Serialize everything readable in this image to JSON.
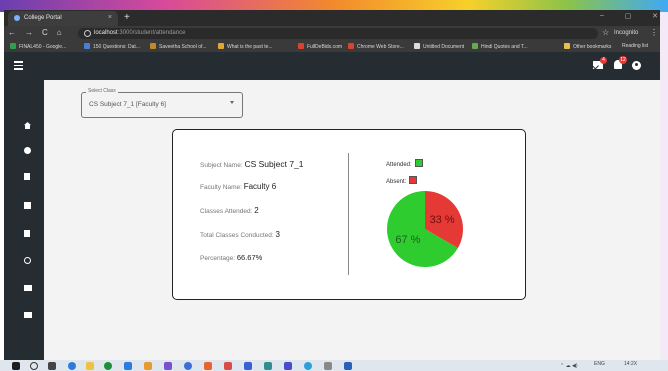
{
  "browser": {
    "tab_title": "College Portal",
    "tab_close": "×",
    "new_tab": "+",
    "window_controls": [
      "–",
      "▢",
      "✕"
    ],
    "nav_buttons": [
      "←",
      "→",
      "C",
      "⌂"
    ],
    "url_host": "localhost",
    "url_path": ":3000/student/attendance",
    "incognito_label": "Incognito",
    "menu_dots": "⋮",
    "bookmarks": [
      {
        "label": "FINAL450 - Google...",
        "color": "#2e9e4f"
      },
      {
        "label": "150 Questions: Dat...",
        "color": "#4a7fd6"
      },
      {
        "label": "Saveetha School of...",
        "color": "#c08a2a"
      },
      {
        "label": "What is the past te...",
        "color": "#e0a82e"
      },
      {
        "label": "FullDeBids.com",
        "color": "#d9432f"
      },
      {
        "label": "Chrome Web Store...",
        "color": "#d9432f"
      },
      {
        "label": "Untitled Document",
        "color": "#dddddd"
      },
      {
        "label": "Hindi Quotes and T...",
        "color": "#6aa84f"
      }
    ],
    "bookmarks_right": [
      "Other bookmarks",
      "Reading list"
    ]
  },
  "header": {
    "mail_badge": "4",
    "notification_badge": "12"
  },
  "sidebar": {
    "items": [
      "home-icon",
      "account-icon",
      "document-icon",
      "library-icon",
      "assignment-icon",
      "clock-icon",
      "video-icon",
      "chat-icon"
    ]
  },
  "select": {
    "label": "Select Class",
    "value": "CS Subject 7_1 [Faculty 6]"
  },
  "details": {
    "subject_label": "Subject Name:",
    "subject_value": "CS Subject 7_1",
    "faculty_label": "Faculty Name:",
    "faculty_value": "Faculty 6",
    "attended_label": "Classes Attended:",
    "attended_value": "2",
    "total_label": "Total Classes Conducted:",
    "total_value": "3",
    "percentage_label": "Percentage:",
    "percentage_value": "66.67%"
  },
  "chart_data": {
    "type": "pie",
    "legend": [
      {
        "label": "Attended:",
        "color": "#2ecc2e"
      },
      {
        "label": "Absent:",
        "color": "#e53935"
      }
    ],
    "slices": [
      {
        "label": "67 %",
        "value": 66.67,
        "color": "#2ecc2e"
      },
      {
        "label": "33 %",
        "value": 33.33,
        "color": "#e53935"
      }
    ]
  },
  "taskbar": {
    "lang": "ENG",
    "time": "14:2X"
  }
}
